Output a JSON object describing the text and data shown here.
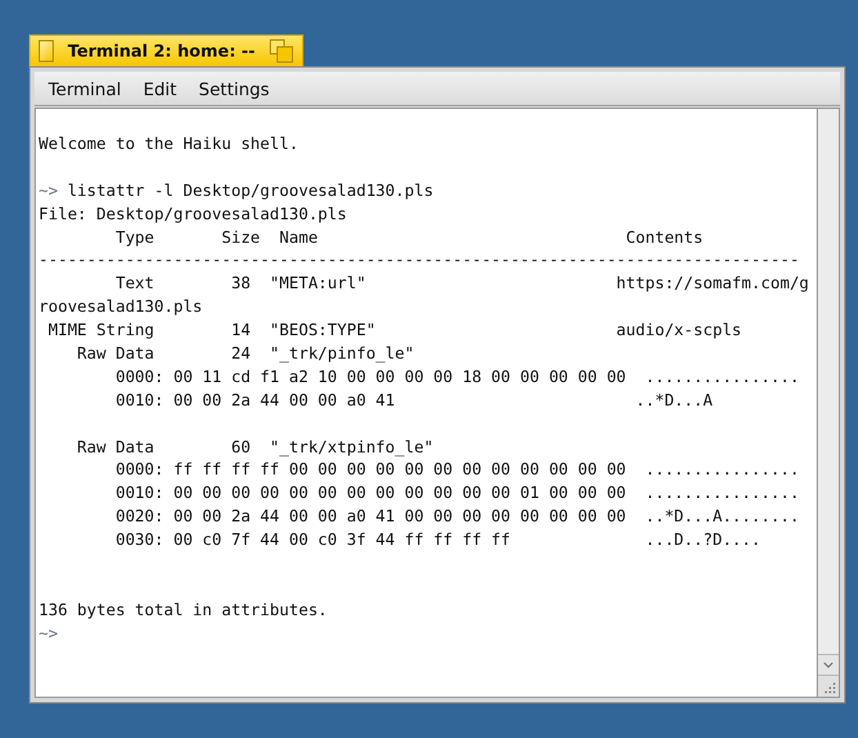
{
  "window": {
    "title": "Terminal 2: home: --"
  },
  "menu": [
    "Terminal",
    "Edit",
    "Settings"
  ],
  "lines": [
    {
      "kind": "text",
      "text": "Welcome to the Haiku shell."
    },
    {
      "kind": "blank"
    },
    {
      "kind": "prompt",
      "prompt": "~>",
      "command": " listattr -l Desktop/groovesalad130.pls"
    },
    {
      "kind": "text",
      "text": "File: Desktop/groovesalad130.pls"
    },
    {
      "kind": "text",
      "text": "        Type       Size  Name                                Contents"
    },
    {
      "kind": "text",
      "text": "-------------------------------------------------------------------------------"
    },
    {
      "kind": "text",
      "text": "        Text        38  \"META:url\"                          https://somafm.com/g"
    },
    {
      "kind": "text",
      "text": "roovesalad130.pls"
    },
    {
      "kind": "text",
      "text": " MIME String        14  \"BEOS:TYPE\"                         audio/x-scpls"
    },
    {
      "kind": "text",
      "text": "    Raw Data        24  \"_trk/pinfo_le\""
    },
    {
      "kind": "text",
      "text": "        0000: 00 11 cd f1 a2 10 00 00 00 00 18 00 00 00 00 00  ................"
    },
    {
      "kind": "text",
      "text": "        0010: 00 00 2a 44 00 00 a0 41                         ..*D...A"
    },
    {
      "kind": "blank"
    },
    {
      "kind": "text",
      "text": "    Raw Data        60  \"_trk/xtpinfo_le\""
    },
    {
      "kind": "text",
      "text": "        0000: ff ff ff ff 00 00 00 00 00 00 00 00 00 00 00 00  ................"
    },
    {
      "kind": "text",
      "text": "        0010: 00 00 00 00 00 00 00 00 00 00 00 00 01 00 00 00  ................"
    },
    {
      "kind": "text",
      "text": "        0020: 00 00 2a 44 00 00 a0 41 00 00 00 00 00 00 00 00  ..*D...A........"
    },
    {
      "kind": "text",
      "text": "        0030: 00 c0 7f 44 00 c0 3f 44 ff ff ff ff              ...D..?D...."
    },
    {
      "kind": "blank"
    },
    {
      "kind": "blank"
    },
    {
      "kind": "text",
      "text": "136 bytes total in attributes."
    },
    {
      "kind": "prompt",
      "prompt": "~>"
    }
  ]
}
